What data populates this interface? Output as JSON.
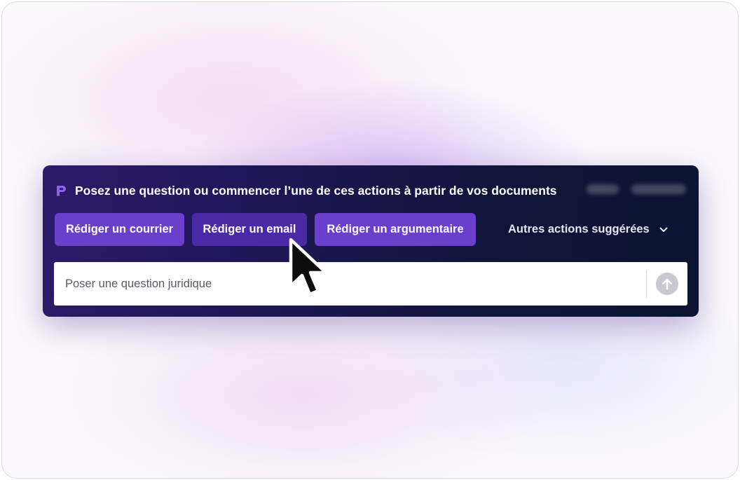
{
  "header": {
    "title": "Posez une question ou commencer l’une de ces actions à partir de vos documents",
    "logo_icon": "brand-p-logo-icon"
  },
  "actions": [
    {
      "label": "Rédiger un courrier"
    },
    {
      "label": "Rédiger un email",
      "state": "hovered"
    },
    {
      "label": "Rédiger un argumentaire"
    }
  ],
  "more_actions": {
    "label": "Autres actions suggérées",
    "icon": "chevron-down-icon"
  },
  "question_input": {
    "placeholder": "Poser une question juridique",
    "value": "",
    "send_icon": "arrow-up-icon"
  },
  "colors": {
    "panel_start": "#2d1a6a",
    "panel_end": "#0b1432",
    "button": "#6a3fcb",
    "button_active": "#4a2aa6",
    "logo": "#8f63e6"
  }
}
